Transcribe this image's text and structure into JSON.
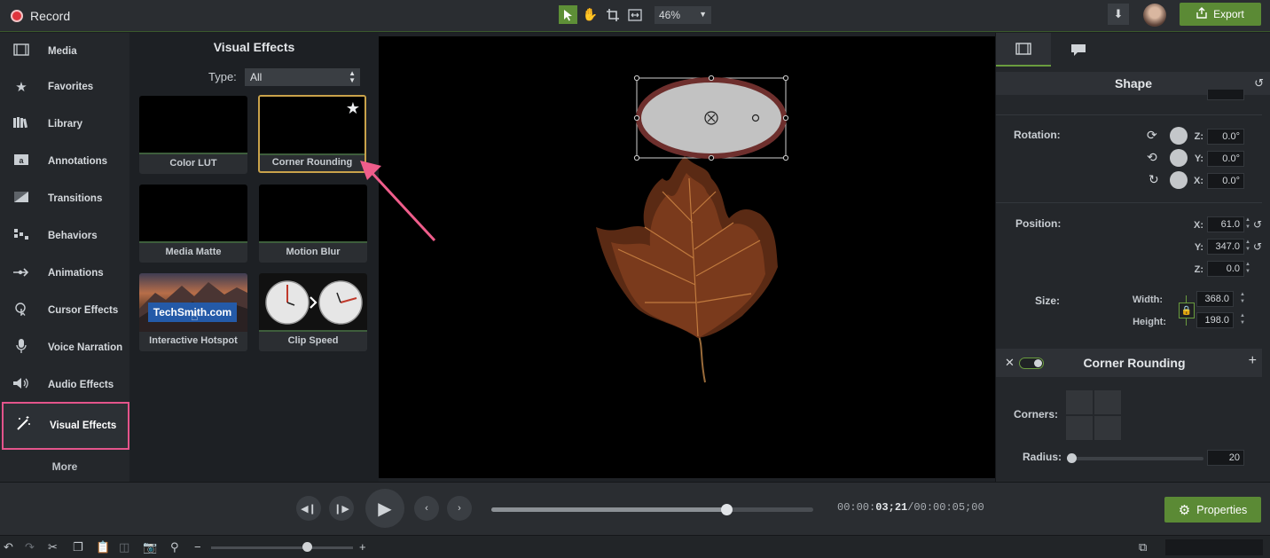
{
  "topbar": {
    "record_label": "Record",
    "zoom_value": "46%",
    "export_label": "Export"
  },
  "sidebar": {
    "items": [
      {
        "label": "Media",
        "icon": "film-icon"
      },
      {
        "label": "Favorites",
        "icon": "star-icon"
      },
      {
        "label": "Library",
        "icon": "library-icon"
      },
      {
        "label": "Annotations",
        "icon": "annotation-icon"
      },
      {
        "label": "Transitions",
        "icon": "transition-icon"
      },
      {
        "label": "Behaviors",
        "icon": "behavior-icon"
      },
      {
        "label": "Animations",
        "icon": "animation-icon"
      },
      {
        "label": "Cursor Effects",
        "icon": "cursor-icon"
      },
      {
        "label": "Voice Narration",
        "icon": "microphone-icon"
      },
      {
        "label": "Audio Effects",
        "icon": "speaker-icon"
      },
      {
        "label": "Visual Effects",
        "icon": "magic-wand-icon"
      }
    ],
    "selected": "Visual Effects",
    "more_label": "More"
  },
  "effects_panel": {
    "title": "Visual Effects",
    "type_label": "Type:",
    "type_value": "All",
    "cards": [
      {
        "label": "Color LUT"
      },
      {
        "label": "Corner Rounding",
        "selected": true,
        "favorite": true
      },
      {
        "label": "Media Matte"
      },
      {
        "label": "Motion Blur"
      },
      {
        "label": "Interactive Hotspot",
        "thumb_text": "TechSmith.com"
      },
      {
        "label": "Clip Speed"
      }
    ]
  },
  "properties": {
    "shape_title": "Shape",
    "rotation": {
      "label": "Rotation:",
      "z_label": "Z:",
      "z": "0.0°",
      "y_label": "Y:",
      "y": "0.0°",
      "x_label": "X:",
      "x": "0.0°"
    },
    "position": {
      "label": "Position:",
      "x_label": "X:",
      "x": "61.0",
      "y_label": "Y:",
      "y": "347.0",
      "z_label": "Z:",
      "z": "0.0"
    },
    "size": {
      "label": "Size:",
      "width_label": "Width:",
      "width": "368.0",
      "height_label": "Height:",
      "height": "198.0"
    },
    "corner_rounding": {
      "title": "Corner Rounding",
      "corners_label": "Corners:",
      "radius_label": "Radius:",
      "radius": "20"
    }
  },
  "transport": {
    "timecode_prefix": "00:00:",
    "timecode_current": "03;21",
    "timecode_total": "/00:00:05;00",
    "playhead_fraction": 0.73,
    "properties_label": "Properties"
  },
  "colors": {
    "accent_green": "#5b8a35",
    "highlight_pink": "#e4548b",
    "selected_gold": "#c9a24a"
  }
}
